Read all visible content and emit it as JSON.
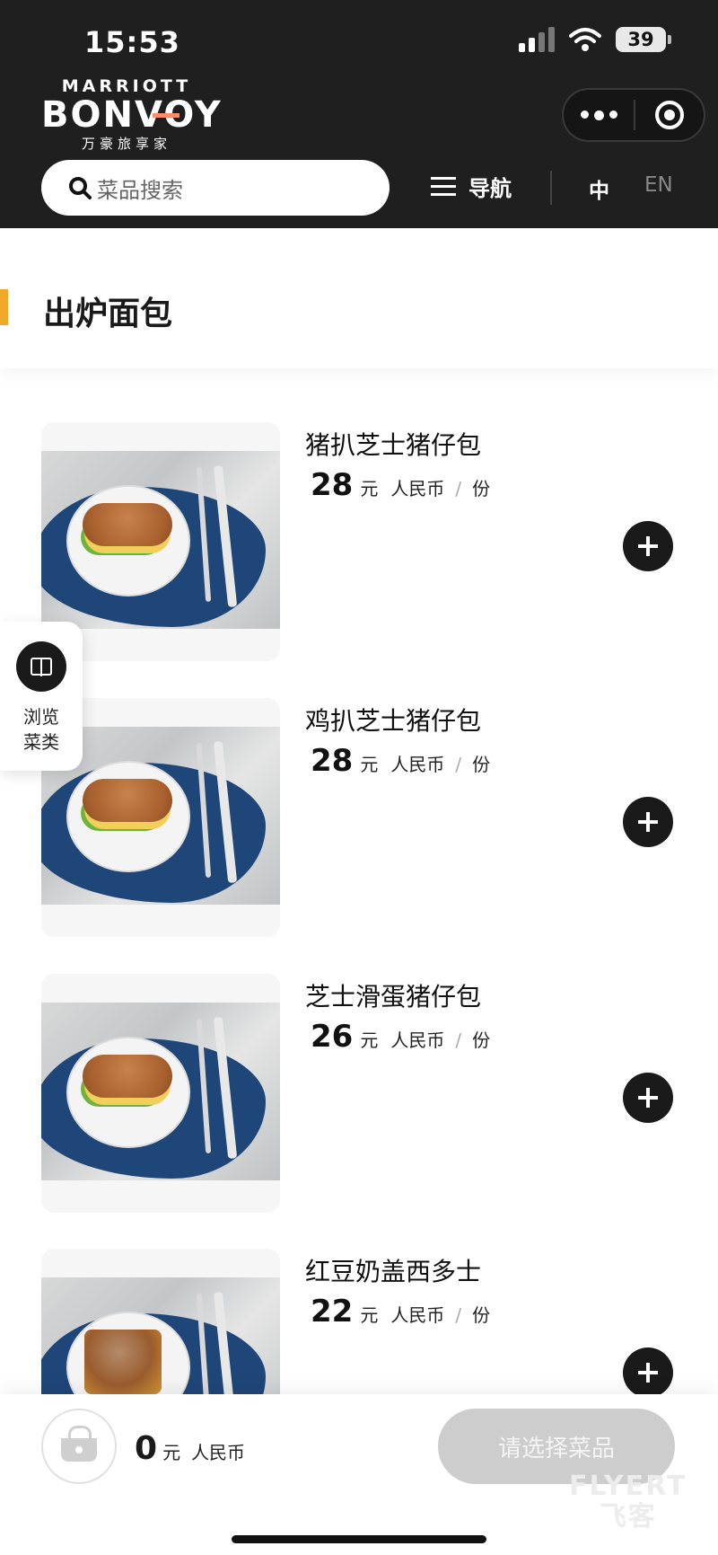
{
  "status_bar": {
    "time": "15:53",
    "battery": "39"
  },
  "brand": {
    "line1": "MARRIOTT",
    "line2": "BONVOY",
    "line3": "万豪旅享家"
  },
  "search": {
    "placeholder": "菜品搜索"
  },
  "nav": {
    "label": "导航"
  },
  "language": {
    "zh": "中",
    "en": "EN"
  },
  "category": {
    "title": "出炉面包",
    "accent_color": "#f0a72a"
  },
  "menu_items": [
    {
      "name": "猪扒芝士猪仔包",
      "price": "28",
      "unit": "元",
      "currency": "人民币",
      "slash": "/",
      "per": "份",
      "photo": "sandwich"
    },
    {
      "name": "鸡扒芝士猪仔包",
      "price": "28",
      "unit": "元",
      "currency": "人民币",
      "slash": "/",
      "per": "份",
      "photo": "sandwich"
    },
    {
      "name": "芝士滑蛋猪仔包",
      "price": "26",
      "unit": "元",
      "currency": "人民币",
      "slash": "/",
      "per": "份",
      "photo": "sandwich"
    },
    {
      "name": "红豆奶盖西多士",
      "price": "22",
      "unit": "元",
      "currency": "人民币",
      "slash": "/",
      "per": "份",
      "photo": "toast"
    }
  ],
  "browse": {
    "label_line1": "浏览",
    "label_line2": "菜类",
    "icon": "book-icon"
  },
  "cart": {
    "total": "0",
    "unit": "元",
    "currency": "人民币",
    "icon": "basket-icon"
  },
  "checkout": {
    "label": "请选择菜品"
  },
  "watermark": {
    "line1": "FLYERT",
    "line2": "飞客"
  },
  "colors": {
    "header_bg": "#1f1f1f",
    "button_dark": "#1a1a1a",
    "checkout_disabled": "#cdcdcd"
  }
}
